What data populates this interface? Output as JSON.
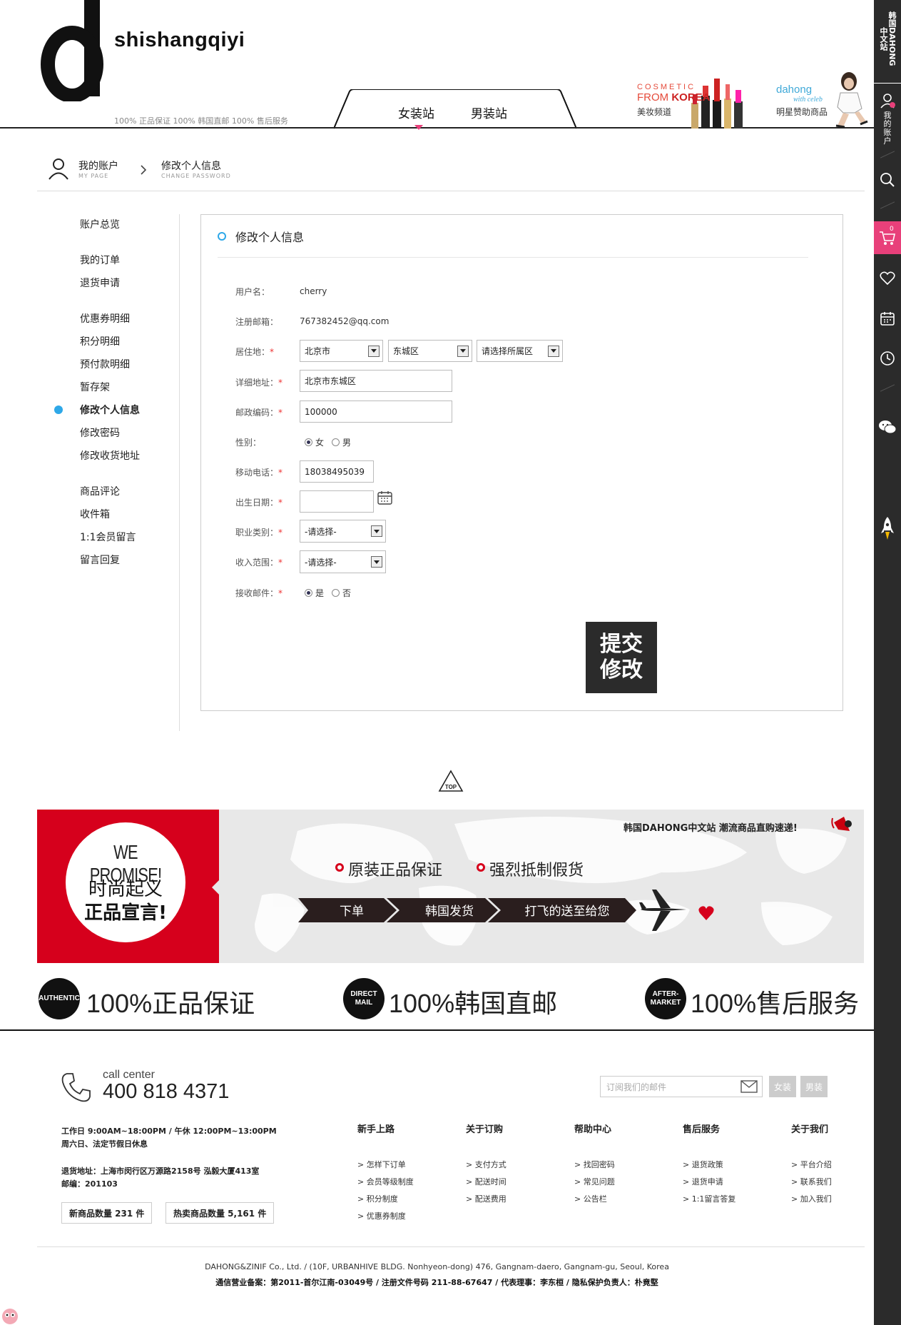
{
  "header": {
    "brand": "shishangqiyi",
    "promise_line": "100% 正品保证  100% 韩国直邮  100% 售后服务",
    "nav": {
      "women": "女装站",
      "men": "男装站"
    },
    "cosmetic": {
      "title": "COSMETIC",
      "sub_from": "FROM ",
      "sub_korea": "KOREA",
      "cn": "美妆频道"
    },
    "celeb": {
      "brand": "dahong",
      "with": "with celeb",
      "cn": "明星赞助商品"
    }
  },
  "sidebar": {
    "site_label": "韩国DAHONG中文站",
    "account_label": "我的账户",
    "cart_count": "0",
    "icons": [
      "user-icon",
      "search-icon",
      "cart-icon",
      "heart-icon",
      "calendar-icon",
      "clock-icon",
      "wechat-icon",
      "rocket-icon"
    ]
  },
  "breadcrumb": {
    "home_cn": "我的账户",
    "home_en": "MY PAGE",
    "current_cn": "修改个人信息",
    "current_en": "CHANGE PASSWORD"
  },
  "left_menu": {
    "overview": "账户总览",
    "orders": "我的订单",
    "returns": "退货申请",
    "coupons": "优惠券明细",
    "points": "积分明细",
    "prepaid": "预付款明细",
    "saved": "暂存架",
    "profile": "修改个人信息",
    "password": "修改密码",
    "address": "修改收货地址",
    "reviews": "商品评论",
    "inbox": "收件箱",
    "qa": "1:1会员留言",
    "replies": "留言回复"
  },
  "form": {
    "title": "修改个人信息",
    "labels": {
      "username": "用户名：",
      "email": "注册邮箱：",
      "region": "居住地：",
      "address": "详细地址：",
      "zip": "邮政编码：",
      "gender": "性别：",
      "mobile": "移动电话：",
      "birthday": "出生日期：",
      "job": "职业类别：",
      "income": "收入范围：",
      "newsletter": "接收邮件："
    },
    "required_mark": "*",
    "values": {
      "username": "cherry",
      "email": "767382452@qq.com",
      "province": "北京市",
      "district": "东城区",
      "area": "请选择所属区",
      "address": "北京市东城区",
      "zip": "100000",
      "mobile": "18038495039",
      "birthday": "",
      "job": "-请选择-",
      "income": "-请选择-"
    },
    "gender_options": {
      "female": "女",
      "male": "男"
    },
    "newsletter_options": {
      "yes": "是",
      "no": "否"
    },
    "submit_line1": "提交",
    "submit_line2": "修改"
  },
  "top_button": "TOP",
  "promise": {
    "we": "WE PROMISE!",
    "line1": "时尚起义",
    "line2": "正品宣言!",
    "banner_title": "韩国DAHONG中文站 潮流商品直购速递!",
    "point1": "原装正品保证",
    "point2": "强烈抵制假货",
    "step1": "下单",
    "step2": "韩国发货",
    "step3": "打飞的送至给您",
    "accent": "#d6001c"
  },
  "guarantees": [
    {
      "badge": "AUTHENTIC",
      "text": "100%正品保证"
    },
    {
      "badge": "DIRECT MAIL",
      "text": "100%韩国直邮"
    },
    {
      "badge": "AFTER-MARKET",
      "text": "100%售后服务"
    }
  ],
  "footer": {
    "call_label": "call center",
    "call_number": "400 818 4371",
    "hours1": "工作日 9:00AM~18:00PM / 午休 12:00PM~13:00PM",
    "hours2": "周六日、法定节假日休息",
    "return_addr": "退货地址：上海市闵行区万源路2158号 泓毅大厦413室",
    "postcode": "邮编：201103",
    "new_count": "新商品数量 231 件",
    "hot_count": "热卖商品数量 5,161 件",
    "subscribe_placeholder": "订阅我们的邮件",
    "sub_women": "女装",
    "sub_men": "男装",
    "columns": [
      {
        "title": "新手上路",
        "items": [
          "> 怎样下订单",
          "> 会员等级制度",
          "> 积分制度",
          "> 优惠券制度"
        ]
      },
      {
        "title": "关于订购",
        "items": [
          "> 支付方式",
          "> 配送时间",
          "> 配送费用"
        ]
      },
      {
        "title": "帮助中心",
        "items": [
          "> 找回密码",
          "> 常见问题",
          "> 公告栏"
        ]
      },
      {
        "title": "售后服务",
        "items": [
          "> 退货政策",
          "> 退货申请",
          "> 1:1留言答复"
        ]
      },
      {
        "title": "关于我们",
        "items": [
          "> 平台介绍",
          "> 联系我们",
          "> 加入我们"
        ]
      }
    ],
    "company": "DAHONG&ZINIF Co., Ltd. / (10F, URBANHIVE BLDG. Nonhyeon-dong) 476, Gangnam-daero, Gangnam-gu, Seoul, Korea",
    "license": "通信营业备案：第2011-首尔江南-03049号 / 注册文件号码 211-88-67647 / 代表理事：李东桓 / 隐私保护负责人：朴竟堅"
  }
}
